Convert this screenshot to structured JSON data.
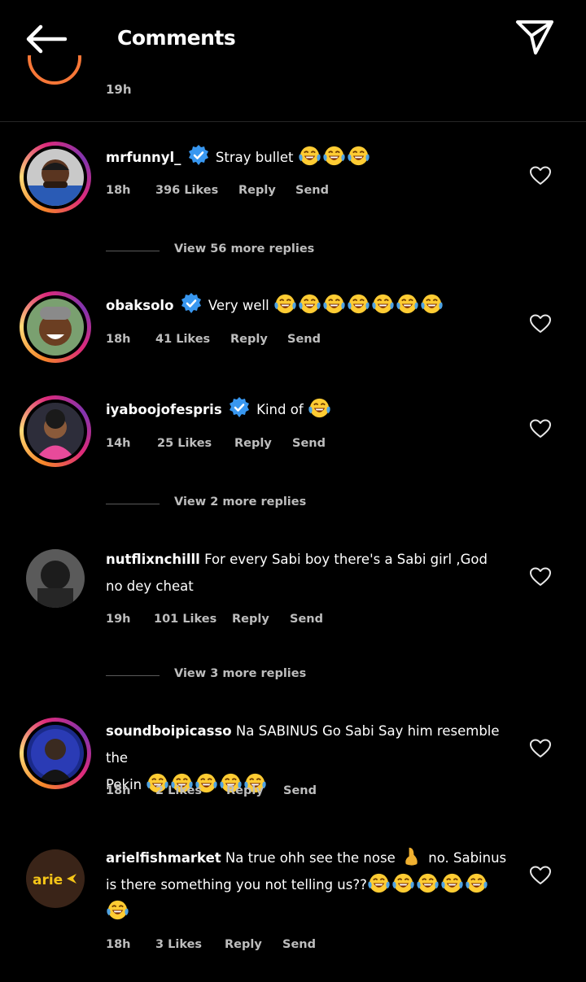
{
  "header": {
    "title": "Comments"
  },
  "previous": {
    "time": "19h"
  },
  "comments": [
    {
      "username": "mrfunnyl_",
      "verified": true,
      "text": "Stray bullet",
      "emoji_count": 3,
      "time": "18h",
      "likes": "396 Likes",
      "reply": "Reply",
      "send": "Send",
      "view_replies": "View 56 more replies"
    },
    {
      "username": "obaksolo",
      "verified": true,
      "text": "Very well",
      "emoji_count": 7,
      "time": "18h",
      "likes": "41 Likes",
      "reply": "Reply",
      "send": "Send"
    },
    {
      "username": "iyaboojofespris",
      "verified": true,
      "text": "Kind of",
      "emoji_count": 1,
      "time": "14h",
      "likes": "25 Likes",
      "reply": "Reply",
      "send": "Send",
      "view_replies": "View 2 more replies"
    },
    {
      "username": "nutflixnchilll",
      "verified": false,
      "text_line1": "For every Sabi boy there's a Sabi girl ,God",
      "text_line2": "no dey cheat",
      "time": "19h",
      "likes": "101 Likes",
      "reply": "Reply",
      "send": "Send",
      "view_replies": "View 3 more replies"
    },
    {
      "username": "soundboipicasso",
      "verified": false,
      "text_line1": "Na SABINUS Go Sabi Say him resemble the",
      "text_line2": "Pekin",
      "emoji_count": 5,
      "time": "18h",
      "likes": "2 Likes",
      "reply": "Reply",
      "send": "Send"
    },
    {
      "username": "arielfishmarket",
      "verified": false,
      "text_line1": "Na true ohh see the nose",
      "text_line1b": "no. Sabinus",
      "text_line2": "is there something you not telling us??",
      "emoji_count": 6,
      "time": "18h",
      "likes": "3 Likes",
      "reply": "Reply",
      "send": "Send",
      "avatar_text": "arie"
    }
  ],
  "colors": {
    "verified": "#3897f0",
    "ring_orange": "#f58529",
    "ring_pink": "#dd2a7b",
    "emoji_face": "#ffcc33",
    "tear": "#4fa3e3"
  }
}
